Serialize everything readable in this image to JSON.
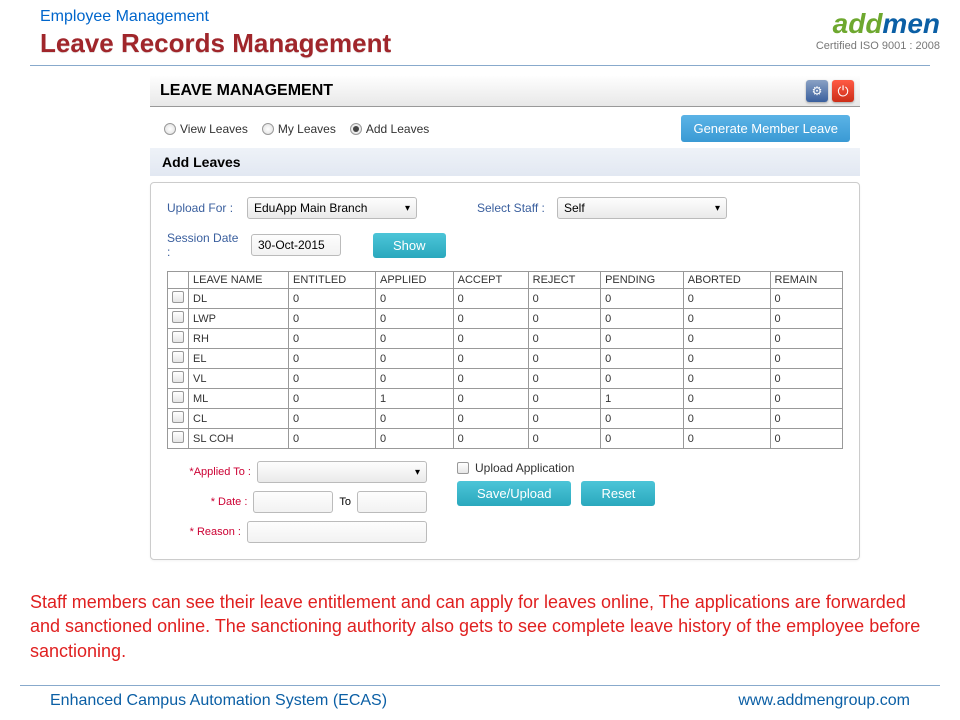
{
  "header": {
    "breadcrumb": "Employee Management",
    "title": "Leave Records Management",
    "logo_part1": "add",
    "logo_part2": "men",
    "cert": "Certified ISO 9001 : 2008"
  },
  "panel": {
    "title": "LEAVE MANAGEMENT",
    "tabs": [
      {
        "label": "View Leaves",
        "selected": false
      },
      {
        "label": "My Leaves",
        "selected": false
      },
      {
        "label": "Add Leaves",
        "selected": true
      }
    ],
    "generate_btn": "Generate Member Leave",
    "section_label": "Add Leaves"
  },
  "form": {
    "upload_for_label": "Upload For :",
    "upload_for_value": "EduApp Main Branch",
    "select_staff_label": "Select Staff :",
    "select_staff_value": "Self",
    "session_date_label": "Session Date :",
    "session_date_value": "30-Oct-2015",
    "show_btn": "Show"
  },
  "table": {
    "headers": [
      "",
      "LEAVE NAME",
      "ENTITLED",
      "APPLIED",
      "ACCEPT",
      "REJECT",
      "PENDING",
      "ABORTED",
      "REMAIN"
    ],
    "rows": [
      {
        "name": "DL",
        "entitled": "0",
        "applied": "0",
        "accept": "0",
        "reject": "0",
        "pending": "0",
        "aborted": "0",
        "remain": "0"
      },
      {
        "name": "LWP",
        "entitled": "0",
        "applied": "0",
        "accept": "0",
        "reject": "0",
        "pending": "0",
        "aborted": "0",
        "remain": "0"
      },
      {
        "name": "RH",
        "entitled": "0",
        "applied": "0",
        "accept": "0",
        "reject": "0",
        "pending": "0",
        "aborted": "0",
        "remain": "0"
      },
      {
        "name": "EL",
        "entitled": "0",
        "applied": "0",
        "accept": "0",
        "reject": "0",
        "pending": "0",
        "aborted": "0",
        "remain": "0"
      },
      {
        "name": "VL",
        "entitled": "0",
        "applied": "0",
        "accept": "0",
        "reject": "0",
        "pending": "0",
        "aborted": "0",
        "remain": "0"
      },
      {
        "name": "ML",
        "entitled": "0",
        "applied": "1",
        "accept": "0",
        "reject": "0",
        "pending": "1",
        "aborted": "0",
        "remain": "0"
      },
      {
        "name": "CL",
        "entitled": "0",
        "applied": "0",
        "accept": "0",
        "reject": "0",
        "pending": "0",
        "aborted": "0",
        "remain": "0"
      },
      {
        "name": "SL COH",
        "entitled": "0",
        "applied": "0",
        "accept": "0",
        "reject": "0",
        "pending": "0",
        "aborted": "0",
        "remain": "0"
      }
    ]
  },
  "apply": {
    "applied_to_label": "*Applied To :",
    "date_label": "* Date :",
    "to_label": "To",
    "reason_label": "* Reason :",
    "upload_app_label": "Upload Application",
    "save_btn": "Save/Upload",
    "reset_btn": "Reset"
  },
  "description": "Staff members can see their leave entitlement and can apply for leaves online, The applications are forwarded and sanctioned online. The sanctioning authority also gets to see complete leave history of the employee before sanctioning.",
  "footer": {
    "left": "Enhanced Campus Automation System (ECAS)",
    "right": "www.addmengroup.com"
  }
}
